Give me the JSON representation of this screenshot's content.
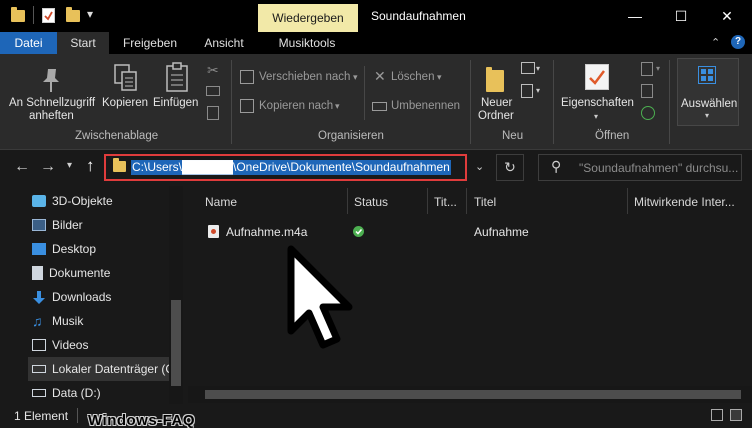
{
  "titlebar": {
    "context_tab": "Wiedergeben",
    "window_title": "Soundaufnahmen",
    "minimize": "—",
    "maximize": "☐",
    "close": "✕"
  },
  "tabs": [
    {
      "label": "Datei"
    },
    {
      "label": "Start"
    },
    {
      "label": "Freigeben"
    },
    {
      "label": "Ansicht"
    },
    {
      "label": "Musiktools"
    }
  ],
  "ribbon": {
    "clipboard": {
      "pin_line1": "An Schnellzugriff",
      "pin_line2": "anheften",
      "copy": "Kopieren",
      "paste": "Einfügen",
      "group": "Zwischenablage"
    },
    "organize": {
      "move": "Verschieben nach",
      "copy_to": "Kopieren nach",
      "delete": "Löschen",
      "rename": "Umbenennen",
      "group": "Organisieren"
    },
    "new": {
      "line1": "Neuer",
      "line2": "Ordner",
      "group": "Neu"
    },
    "open": {
      "properties": "Eigenschaften",
      "group": "Öffnen"
    },
    "select": {
      "label": "Auswählen"
    }
  },
  "address": {
    "path": "C:\\Users\\██████\\OneDrive\\Dokumente\\Soundaufnahmen",
    "search_placeholder": "\"Soundaufnahmen\" durchsu..."
  },
  "nav_items": [
    {
      "label": "3D-Objekte",
      "icon": "cube-icon",
      "color": "#5ab4e8"
    },
    {
      "label": "Bilder",
      "icon": "pictures-icon",
      "color": "#9ab7d6"
    },
    {
      "label": "Desktop",
      "icon": "desktop-icon",
      "color": "#3a8fe0"
    },
    {
      "label": "Dokumente",
      "icon": "documents-icon",
      "color": "#cfd6de"
    },
    {
      "label": "Downloads",
      "icon": "download-icon",
      "color": "#3a8fe0"
    },
    {
      "label": "Musik",
      "icon": "music-icon",
      "color": "#3a8fe0"
    },
    {
      "label": "Videos",
      "icon": "videos-icon",
      "color": "#cfd6de"
    },
    {
      "label": "Lokaler Datenträger (C",
      "icon": "drive-icon",
      "color": "#cfd6de"
    },
    {
      "label": "Data (D:)",
      "icon": "drive-icon",
      "color": "#cfd6de"
    }
  ],
  "columns": [
    "Name",
    "Status",
    "Tit...",
    "Titel",
    "Mitwirkende Inter..."
  ],
  "files": [
    {
      "name": "Aufnahme.m4a",
      "titel": "Aufnahme",
      "icon": "audio-file-icon"
    }
  ],
  "status": {
    "count": "1 Element",
    "watermark": "Windows-FAQ"
  },
  "colors": {
    "accent": "#1e66b8",
    "highlight_border": "#e03c3c",
    "context_tab": "#f2e9a8",
    "sync_ok": "#4caf50"
  }
}
